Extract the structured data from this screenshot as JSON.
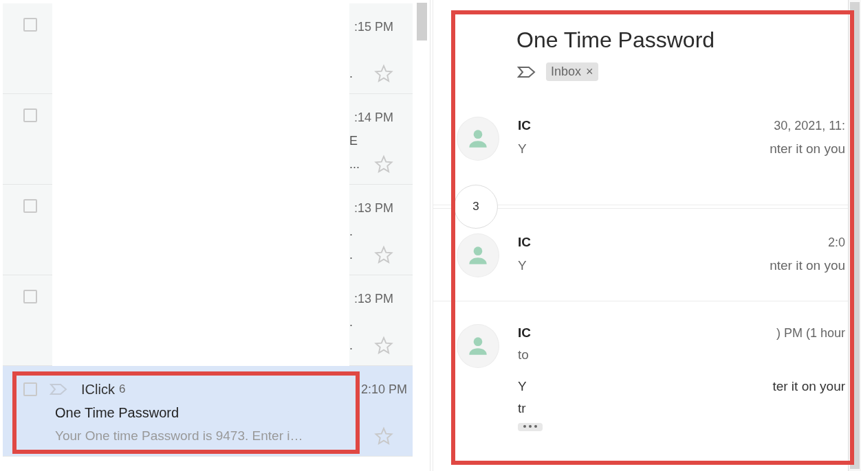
{
  "inbox": {
    "rows": [
      {
        "kind": "redacted",
        "time": ":15 PM",
        "snippet": ".",
        "checked": false,
        "starred": false,
        "selected": false
      },
      {
        "kind": "redacted",
        "time": ":14 PM",
        "subject": "E",
        "snippet": "...",
        "checked": false,
        "starred": false,
        "selected": false
      },
      {
        "kind": "redacted",
        "time": ":13 PM",
        "subject": ".",
        "snippet": ".",
        "checked": false,
        "starred": false,
        "selected": false
      },
      {
        "kind": "redacted",
        "time": ":13 PM",
        "subject": ".",
        "snippet": ".",
        "checked": false,
        "starred": false,
        "selected": false
      },
      {
        "kind": "message",
        "sender": "IClick",
        "count": "6",
        "time": "2:10 PM",
        "subject": "One Time Password",
        "snippet": "Your One time Password is 9473. Enter i…",
        "checked": false,
        "starred": false,
        "selected": true
      }
    ]
  },
  "thread": {
    "title": "One Time Password",
    "labels": [
      {
        "text": "Inbox",
        "remove": "×"
      }
    ],
    "messages": [
      {
        "kind": "message",
        "sender": "IC",
        "date": "30, 2021, 11:",
        "line": "Y",
        "line_end": "nter it on you"
      },
      {
        "kind": "collapsed",
        "count": "3"
      },
      {
        "kind": "message",
        "sender": "IC",
        "date": "2:0",
        "line": "Y",
        "line_end": "nter it on you"
      },
      {
        "kind": "expanded",
        "sender": "IC",
        "date": ") PM (1 hour",
        "to": "to",
        "body": "Y",
        "body_end": "ter it on your",
        "body_last": "tr"
      }
    ]
  }
}
